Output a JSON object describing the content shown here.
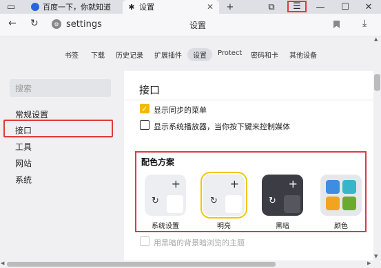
{
  "tabs": [
    {
      "title": "百度一下，你就知道",
      "icon": "baidu-icon"
    },
    {
      "title": "设置",
      "icon": "gear-icon"
    }
  ],
  "address": {
    "url": "settings",
    "title": "设置"
  },
  "settings_nav": [
    "书签",
    "下载",
    "历史记录",
    "扩展插件",
    "设置",
    "Protect",
    "密码和卡",
    "其他设备"
  ],
  "settings_nav_active": "设置",
  "sidebar": {
    "search_placeholder": "搜索",
    "items": [
      "常规设置",
      "接口",
      "工具",
      "网站",
      "系统"
    ],
    "selected": "接口"
  },
  "main": {
    "title": "接口",
    "options": [
      {
        "label": "显示同步的菜单",
        "state": "checked"
      },
      {
        "label": "显示系统播放器，当你按下键来控制媒体",
        "state": "unchecked"
      },
      {
        "label": "用黑暗的背景暗浏览的主题",
        "state": "disabled"
      }
    ],
    "scheme_title": "配色方案",
    "themes": [
      {
        "label": "系统设置",
        "style": "light",
        "selected": false
      },
      {
        "label": "明亮",
        "style": "light",
        "selected": true
      },
      {
        "label": "黑暗",
        "style": "dark",
        "selected": false
      },
      {
        "label": "颜色",
        "style": "color",
        "selected": false
      }
    ]
  },
  "colors": {
    "accent": "#f5b800",
    "highlight_border": "#e03a3a",
    "dark_theme": "#3c3d44"
  }
}
